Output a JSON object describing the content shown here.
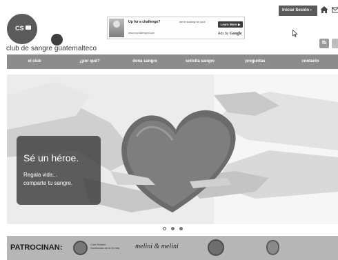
{
  "header": {
    "logo_text": "CS",
    "club_name": "club de sangre guatemalteco",
    "login_label": "Iniciar Sesión",
    "login_chevron": "›",
    "facebook_label": "fb"
  },
  "ad": {
    "title": "Up for a challenge?",
    "tagline": "we're looking for you!",
    "url": "www.mychallengeid.com",
    "button_label": "Learn More ▶",
    "ads_by": "Ads by",
    "google": "Google"
  },
  "nav": {
    "items": [
      "el club",
      "¿por qué?",
      "dona sangre",
      "solicita sangre",
      "preguntas",
      "contacto"
    ]
  },
  "hero": {
    "title": "Sé un héroe.",
    "subtitle_line1": "Regala vida...",
    "subtitle_line2": "comparte tu sangre."
  },
  "slider": {
    "slides": 3,
    "active_index": 0
  },
  "sponsors": {
    "label": "PATROCINAN:",
    "rotary_line1": "Club Rotario",
    "rotary_line2": "Guatemala de la Ermita",
    "melini": "melini & melini"
  },
  "colors": {
    "nav_bg": "#8c8c8c",
    "sponsor_bar_bg": "#b6b6b6",
    "logo_circle": "#5a5a5a"
  }
}
